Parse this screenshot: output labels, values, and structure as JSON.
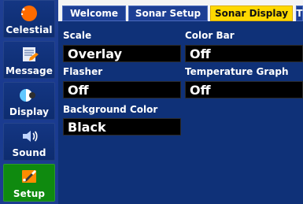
{
  "sidebar": {
    "items": [
      {
        "label": "Celestial",
        "icon": "celestial-icon",
        "active": false
      },
      {
        "label": "Message",
        "icon": "message-icon",
        "active": false
      },
      {
        "label": "Display",
        "icon": "display-icon",
        "active": false
      },
      {
        "label": "Sound",
        "icon": "sound-icon",
        "active": false
      },
      {
        "label": "Setup",
        "icon": "setup-icon",
        "active": true
      }
    ]
  },
  "tabs": [
    {
      "label": "Welcome",
      "active": false
    },
    {
      "label": "Sonar Setup",
      "active": false
    },
    {
      "label": "Sonar Display",
      "active": true
    },
    {
      "label": "T",
      "active": false
    }
  ],
  "fields": {
    "scale": {
      "label": "Scale",
      "value": "Overlay"
    },
    "color_bar": {
      "label": "Color Bar",
      "value": "Off"
    },
    "flasher": {
      "label": "Flasher",
      "value": "Off"
    },
    "temperature_graph": {
      "label": "Temperature Graph",
      "value": "Off"
    },
    "background_color": {
      "label": "Background Color",
      "value": "Black"
    }
  },
  "colors": {
    "sidebar_bg": "#1f3f93",
    "panel_bg": "#0f3178",
    "active_tab": "#ffd900",
    "active_sidebar": "#0f8a0f"
  }
}
